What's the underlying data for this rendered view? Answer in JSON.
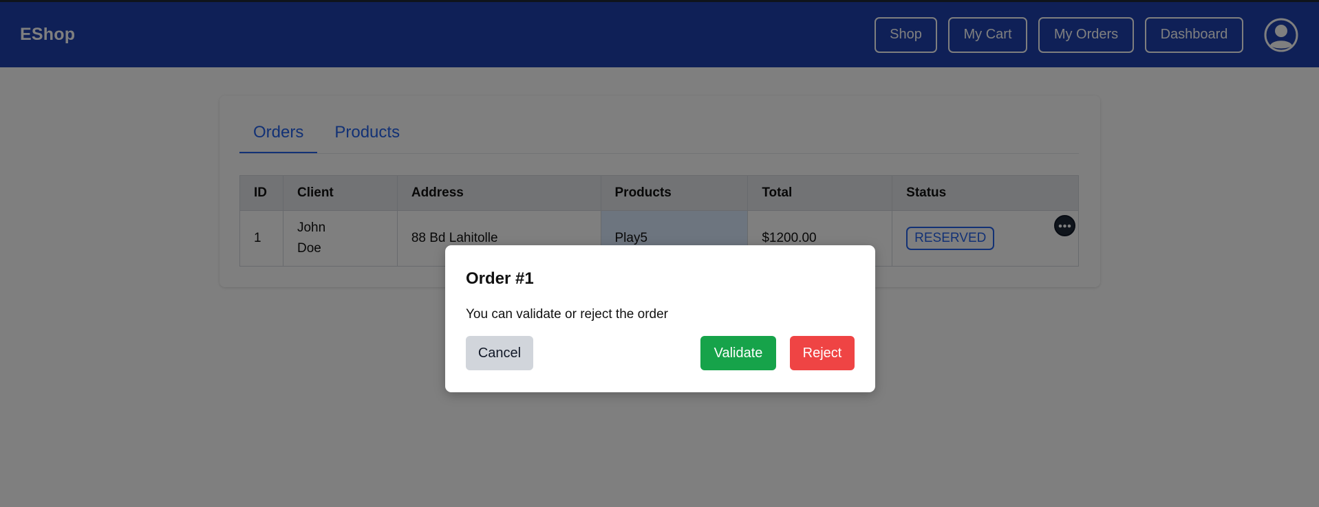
{
  "navbar": {
    "brand": "EShop",
    "links": {
      "shop": "Shop",
      "cart": "My Cart",
      "orders": "My Orders",
      "dashboard": "Dashboard"
    },
    "avatar_icon": "user-circle-icon"
  },
  "tabs": {
    "orders": "Orders",
    "products": "Products"
  },
  "table": {
    "headers": {
      "id": "ID",
      "client": "Client",
      "address": "Address",
      "products": "Products",
      "total": "Total",
      "status": "Status"
    },
    "rows": [
      {
        "id": "1",
        "client_first": "John",
        "client_last": "Doe",
        "address": "88 Bd Lahitolle",
        "products": "Play5",
        "total": "$1200.00",
        "status": "RESERVED",
        "menu_icon": "more-horizontal-icon"
      }
    ]
  },
  "modal": {
    "title": "Order #1",
    "message": "You can validate or reject the order",
    "cancel": "Cancel",
    "validate": "Validate",
    "reject": "Reject"
  },
  "colors": {
    "navbar": "#1e40af",
    "accent": "#2563eb",
    "validate": "#16a34a",
    "reject": "#ef4444",
    "cancel": "#d1d5db"
  }
}
